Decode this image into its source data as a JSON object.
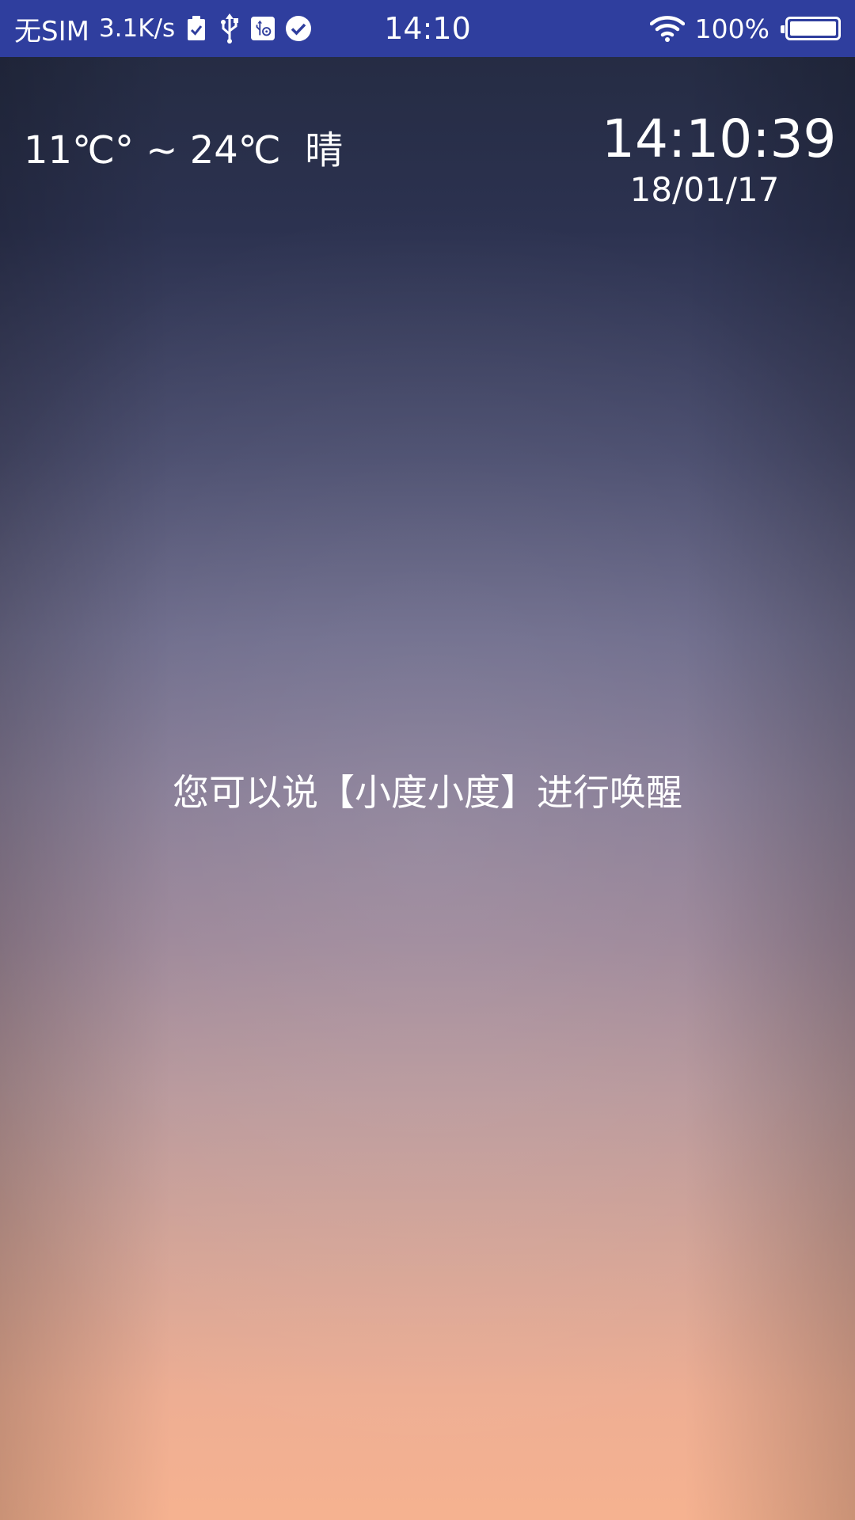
{
  "status_bar": {
    "carrier": "无SIM",
    "net_speed": "3.1K/s",
    "icons": [
      "sim-check-icon",
      "usb-icon",
      "usb-debug-icon",
      "check-circle-icon",
      "wifi-icon",
      "battery-icon"
    ],
    "time": "14:10",
    "battery_percent": "100%",
    "battery_level": 1.0,
    "background_color": "#2f3e9e"
  },
  "weather": {
    "text": "11℃° ~ 24℃  晴"
  },
  "clock": {
    "time": "14:10:39",
    "date": "18/01/17"
  },
  "hint": {
    "text": "您可以说【小度小度】进行唤醒"
  }
}
